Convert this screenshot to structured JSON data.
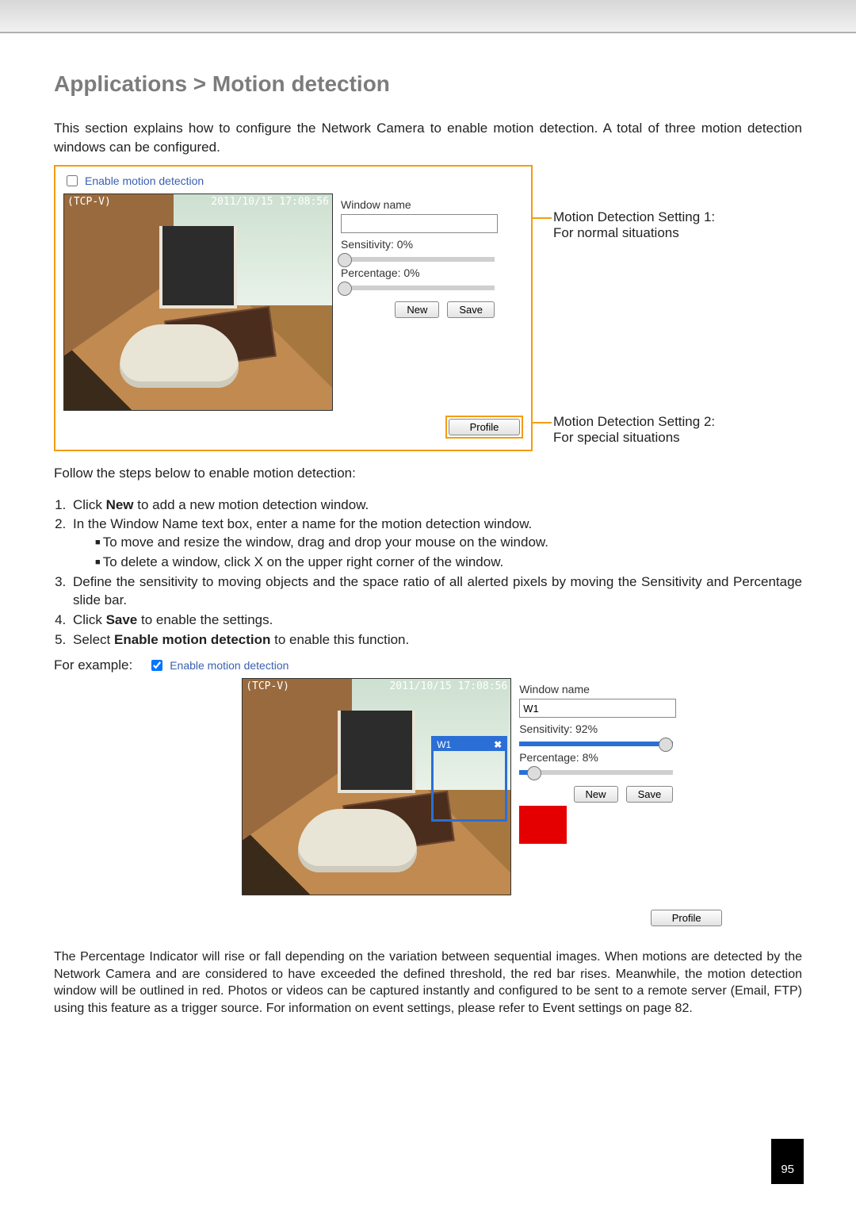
{
  "heading": "Applications > Motion detection",
  "intro": "This section explains how to configure the Network Camera to enable motion detection. A total of three motion detection windows can be configured.",
  "shot1": {
    "enable_label": "Enable motion detection",
    "source": "(TCP-V)",
    "timestamp": "2011/10/15 17:08:56",
    "window_name_label": "Window name",
    "window_name": "",
    "sensitivity_label": "Sensitivity: 0%",
    "percentage_label": "Percentage: 0%",
    "new_btn": "New",
    "save_btn": "Save",
    "profile_btn": "Profile"
  },
  "callout1": {
    "l1": "Motion Detection Setting 1:",
    "l2": "For normal situations"
  },
  "callout2": {
    "l1": "Motion Detection Setting 2:",
    "l2": "For special situations"
  },
  "steps_intro": "Follow the steps below to enable motion detection:",
  "steps": [
    {
      "pre": "Click ",
      "bold": "New",
      "post": " to add a new motion detection window."
    },
    {
      "text": "In the Window Name text box, enter a name for the motion detection window.",
      "sub": [
        "To move and resize the window, drag and drop your mouse on the window.",
        "To delete a window, click X on the upper right corner of the window."
      ]
    },
    {
      "text": "Define the sensitivity to moving objects and the space ratio of all alerted pixels by moving the Sensitivity and Percentage slide bar."
    },
    {
      "pre": "Click ",
      "bold": "Save",
      "post": " to enable the settings."
    },
    {
      "pre": "Select ",
      "bold": "Enable motion detection",
      "post": " to enable this function."
    }
  ],
  "example_label": "For example:",
  "shot2": {
    "enable_label": "Enable motion detection",
    "source": "(TCP-V)",
    "timestamp": "2011/10/15 17:08:56",
    "window_name_label": "Window name",
    "window_name": "W1",
    "mdwin_name": "W1",
    "sensitivity_label": "Sensitivity: 92%",
    "percentage_label": "Percentage: 8%",
    "new_btn": "New",
    "save_btn": "Save",
    "profile_btn": "Profile"
  },
  "closing": "The Percentage Indicator will rise or fall depending on the variation between sequential images. When motions are detected by the Network Camera and are considered to have exceeded the defined threshold, the red bar rises. Meanwhile, the motion detection window will be outlined in red. Photos or videos can be captured instantly and configured to be sent to a remote server (Email, FTP) using this feature as a trigger source. For information on event settings, please refer to Event settings on page 82.",
  "page_number": "95"
}
